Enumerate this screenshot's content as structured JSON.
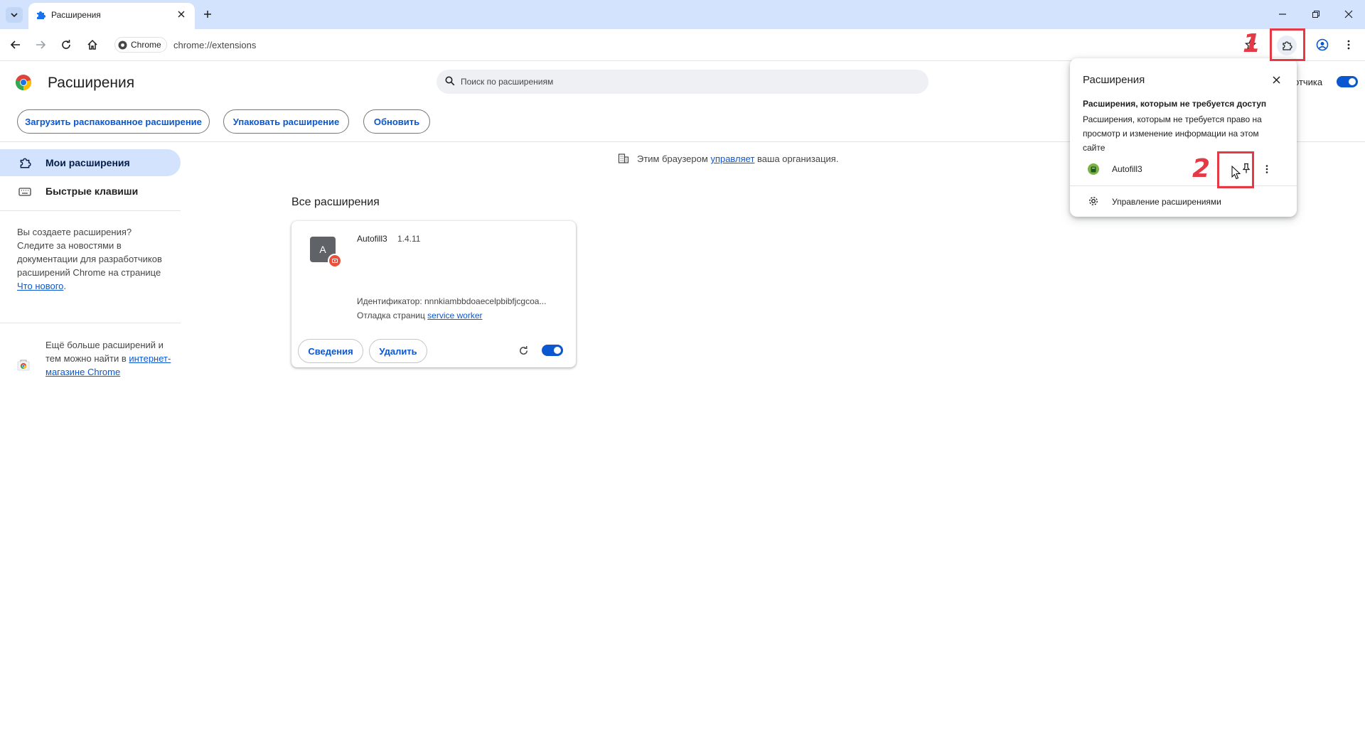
{
  "tab": {
    "title": "Расширения"
  },
  "toolbar": {
    "chip_label": "Chrome",
    "url": "chrome://extensions"
  },
  "header": {
    "title": "Расширения",
    "search_placeholder": "Поиск по расширениям",
    "dev_mode_label": "отчика"
  },
  "actions": {
    "load_unpacked": "Загрузить распакованное расширение",
    "pack": "Упаковать расширение",
    "update": "Обновить"
  },
  "sidebar": {
    "items": [
      {
        "label": "Мои расширения",
        "icon": "puzzle-icon",
        "selected": true
      },
      {
        "label": "Быстрые клавиши",
        "icon": "keyboard-icon",
        "selected": false
      }
    ],
    "dev_promo": {
      "text": "Вы создаете расширения? Следите за новостями в документации для разработчиков расширений Chrome на странице ",
      "link": "Что нового",
      "suffix": "."
    },
    "store_promo": {
      "text": "Ещё больше расширений и тем можно найти в ",
      "link": "интернет-магазине Chrome"
    }
  },
  "managed_notice": {
    "prefix": "Этим браузером ",
    "link": "управляет",
    "suffix": " ваша организация."
  },
  "section_title": "Все расширения",
  "extension": {
    "avatar_letter": "A",
    "name": "Autofill3",
    "version": "1.4.11",
    "id_line": "Идентификатор: nnnkiambbdoaecelpbibfjcgcoa...",
    "debug_prefix": "Отладка страниц ",
    "debug_link": "service worker",
    "details_label": "Сведения",
    "remove_label": "Удалить",
    "enabled": true
  },
  "popup": {
    "title": "Расширения",
    "section_title": "Расширения, которым не требуется доступ",
    "section_desc": "Расширения, которым не требуется право на просмотр и изменение информации на этом сайте",
    "extension_name": "Autofill3",
    "manage_label": "Управление расширениями"
  },
  "annotations": {
    "step1": "1",
    "step2": "2",
    "color": "#e53946"
  },
  "colors": {
    "accent": "#0b57d0",
    "tabstrip": "#d3e3fd",
    "selected_nav": "#d3e3fd"
  }
}
